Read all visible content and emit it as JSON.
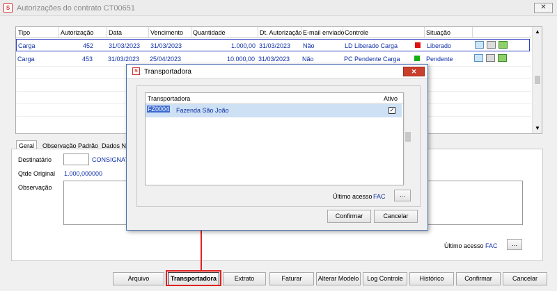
{
  "window": {
    "title": "Autorizações do contrato CT00651",
    "close": "✕"
  },
  "grid": {
    "columns": [
      "Tipo",
      "Autorização",
      "Data",
      "Vencimento",
      "Quantidade",
      "Dt. Autorização",
      "E-mail enviado",
      "Controle",
      "Situação"
    ],
    "rows": [
      {
        "tipo": "Carga",
        "autorizacao": "452",
        "data": "31/03/2023",
        "vencimento": "31/03/2023",
        "quantidade": "1.000,00",
        "dt_autorizacao": "31/03/2023",
        "email": "Não",
        "controle": "LD  Liberado Carga",
        "status_color": "#e01010",
        "situacao": "Liberado"
      },
      {
        "tipo": "Carga",
        "autorizacao": "453",
        "data": "31/03/2023",
        "vencimento": "25/04/2023",
        "quantidade": "10.000,00",
        "dt_autorizacao": "31/03/2023",
        "email": "Não",
        "controle": "PC  Pendente Carga",
        "status_color": "#10b010",
        "situacao": "Pendente"
      }
    ]
  },
  "tabs": [
    "Geral",
    "Observação Padrão",
    "Dados N"
  ],
  "form": {
    "destinatario_label": "Destinatário",
    "destinatario_value": "CONSIGNATA",
    "qtde_label": "Qtde Original",
    "qtde_value": "1.000,000000",
    "obs_label": "Observação",
    "ultimo_label": "Último acesso",
    "ultimo_value": "FAC",
    "more": "..."
  },
  "buttons": {
    "arquivo": "Arquivo",
    "transportadora": "Transportadora",
    "extrato": "Extrato",
    "faturar": "Faturar",
    "alterar_modelo": "Alterar Modelo",
    "log_controle": "Log Controle",
    "historico": "Histórico",
    "confirmar": "Confirmar",
    "cancelar": "Cancelar"
  },
  "dialog": {
    "title": "Transportadora",
    "close": "✕",
    "col_transportadora": "Transportadora",
    "col_ativo": "Ativo",
    "row_code": "FZ0004",
    "row_name": "Fazenda São João",
    "ultimo_label": "Último acesso",
    "ultimo_value": "FAC",
    "more": "...",
    "confirmar": "Confirmar",
    "cancelar": "Cancelar"
  }
}
